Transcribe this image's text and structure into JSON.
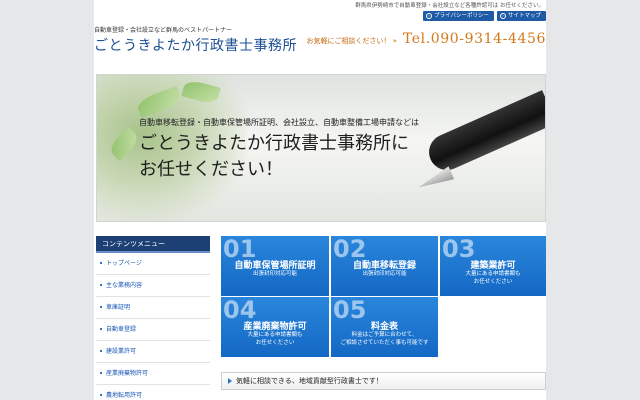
{
  "topbar": {
    "note": "群馬県伊勢崎市で自動車登録・会社設立など各種許認可は お任せください。"
  },
  "header": {
    "tagline": "自動車登録・会社設立など群馬のベストパートナー",
    "site_title": "ごとうきよたか行政書士事務所",
    "links": [
      {
        "label": "プライバシーポリシー"
      },
      {
        "label": "サイトマップ"
      }
    ],
    "contact_lead": "お気軽にご相談ください！ »",
    "tel": "Tel.090-9314-4456"
  },
  "hero": {
    "sub": "自動車移転登録・自動車保管場所証明、会社設立、自動車整備工場申請などは",
    "main_line1": "ごとうきよたか行政書士事務所に",
    "main_line2": "お任せください！"
  },
  "sidebar": {
    "title": "コンテンツメニュー",
    "items": [
      {
        "label": "トップページ"
      },
      {
        "label": "主な業務内容"
      },
      {
        "label": "車庫証明"
      },
      {
        "label": "自動車登録"
      },
      {
        "label": "建設業許可"
      },
      {
        "label": "産業廃棄物許可"
      },
      {
        "label": "農地転用許可"
      }
    ]
  },
  "tiles": [
    {
      "num": "01",
      "title": "自動車保管場所証明",
      "sub": "出張封印対応可能"
    },
    {
      "num": "02",
      "title": "自動車移転登録",
      "sub": "出張封印対応可能"
    },
    {
      "num": "03",
      "title": "建築業許可",
      "sub": "大量にある申請書類も\nお任せください"
    },
    {
      "num": "04",
      "title": "産業廃棄物許可",
      "sub": "大量にある申請書類も\nお任せください"
    },
    {
      "num": "05",
      "title": "料金表",
      "sub": "料金はご予算に合わせて、\nご相談させていただく事も可能です"
    }
  ],
  "banner": {
    "text": "気軽に相談できる、地域貢献型行政書士です！"
  },
  "colors": {
    "accent": "#1f5aa6",
    "tile": "#1b74d0",
    "tel": "#d4781c",
    "sidebar_head": "#1c3f74"
  }
}
